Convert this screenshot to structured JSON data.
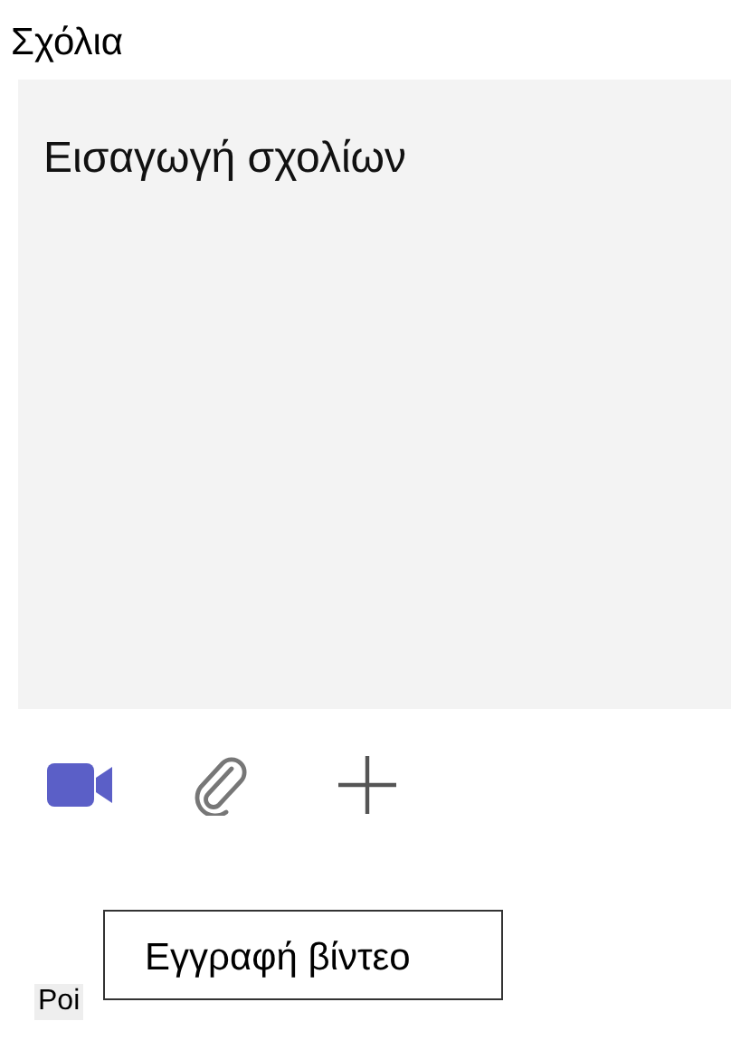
{
  "comments": {
    "label": "Σχόλια",
    "placeholder": "Εισαγωγή σχολίων"
  },
  "toolbar": [
    {
      "kind": "video"
    },
    {
      "kind": "attach"
    },
    {
      "kind": "add"
    }
  ],
  "tooltip": "Εγγραφή βίντεο",
  "next_label": "Poi"
}
